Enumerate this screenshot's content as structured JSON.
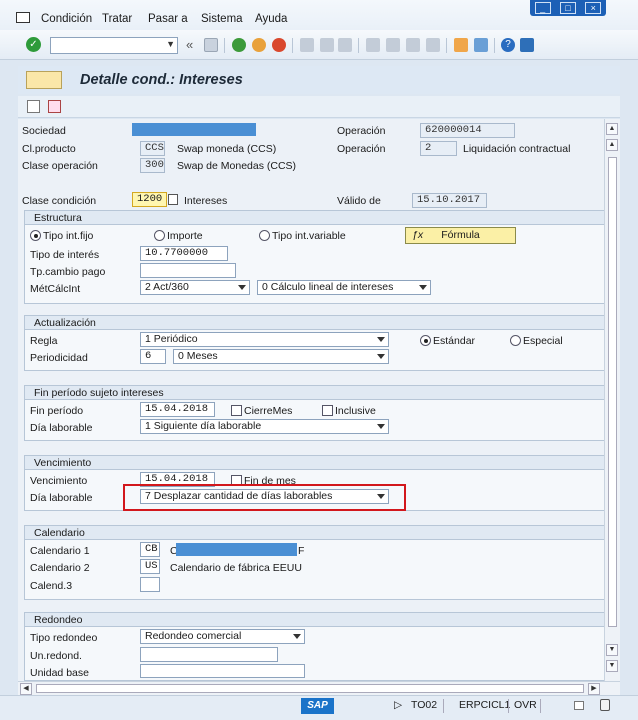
{
  "menu": {
    "items": [
      {
        "label": "Condición"
      },
      {
        "label": "Tratar"
      },
      {
        "label": "Pasar a"
      },
      {
        "label": "Sistema"
      },
      {
        "label": "Ayuda"
      }
    ]
  },
  "toolbar": {
    "command_value": "",
    "back_chevron": "«"
  },
  "header": {
    "title": "Detalle cond.: Intereses"
  },
  "fields": {
    "sociedad_label": "Sociedad",
    "operacion_label": "Operación",
    "operacion_value": "620000014",
    "clproducto_label": "Cl.producto",
    "clproducto_value": "CCS",
    "clproducto_text": "Swap moneda (CCS)",
    "operacion2_label": "Operación",
    "operacion2_value": "2",
    "operacion2_text": "Liquidación contractual",
    "claseop_label": "Clase operación",
    "claseop_value": "300",
    "claseop_text": "Swap de Monedas (CCS)",
    "clasecond_label": "Clase condición",
    "clasecond_value": "1200",
    "clasecond_text": "Intereses",
    "valido_label": "Válido de",
    "valido_value": "15.10.2017"
  },
  "estructura": {
    "title": "Estructura",
    "radio1": "Tipo int.fijo",
    "radio2": "Importe",
    "radio3": "Tipo int.variable",
    "formula": "Fórmula",
    "tipo_interes_label": "Tipo de interés",
    "tipo_interes_value": "10.7700000",
    "tp_cambio_label": "Tp.cambio pago",
    "tp_cambio_value": "",
    "metcalc_label": "MétCálcInt",
    "metcalc_value": "2 Act/360",
    "metcalc2_value": "0 Cálculo lineal de intereses"
  },
  "actualizacion": {
    "title": "Actualización",
    "regla_label": "Regla",
    "regla_value": "1 Periódico",
    "estandar": "Estándar",
    "especial": "Especial",
    "periodicidad_label": "Periodicidad",
    "periodicidad_value": "6",
    "meses_value": "0 Meses"
  },
  "finperiodo": {
    "title": "Fin período sujeto intereses",
    "fin_label": "Fin período",
    "fin_value": "15.04.2018",
    "cierre": "CierreMes",
    "inclusive": "Inclusive",
    "dia_label": "Día laborable",
    "dia_value": "1 Siguiente día laborable"
  },
  "vencimiento": {
    "title": "Vencimiento",
    "venc_label": "Vencimiento",
    "venc_value": "15.04.2018",
    "finmes": "Fin de mes",
    "dia_label": "Día laborable",
    "dia_value": "7 Desplazar cantidad de días laborables"
  },
  "calendario": {
    "title": "Calendario",
    "cal1_label": "Calendario 1",
    "cal1_value": "CB",
    "cal1_text_prefix": "C",
    "cal1_text_suffix": "F",
    "cal2_label": "Calendario 2",
    "cal2_value": "US",
    "cal2_text": "Calendario de fábrica EEUU",
    "cal3_label": "Calend.3",
    "cal3_value": ""
  },
  "redondeo": {
    "title": "Redondeo",
    "tipo_label": "Tipo redondeo",
    "tipo_value": "Redondeo comercial",
    "unredond_label": "Un.redond.",
    "unidad_label": "Unidad base"
  },
  "status": {
    "sap": "SAP",
    "tcode": "TO02",
    "system": "ERPCICL1",
    "mode": "OVR"
  },
  "colors": {
    "accent": "#4a8fd4",
    "highlight": "#d2171c",
    "formula": "#fbf0a6"
  }
}
